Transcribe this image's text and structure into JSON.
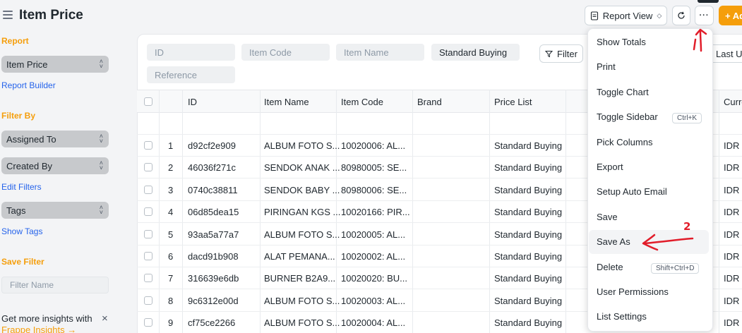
{
  "header": {
    "title": "Item Price",
    "report_view_label": "Report View",
    "more_label": "···",
    "add_label": "+ Ad"
  },
  "sidebar": {
    "report_heading": "Report",
    "report_select": "Item Price",
    "report_builder_link": "Report Builder",
    "filter_by_heading": "Filter By",
    "filter_selects": [
      "Assigned To",
      "Created By"
    ],
    "edit_filters_link": "Edit Filters",
    "tags_select": "Tags",
    "show_tags_link": "Show Tags",
    "save_filter_heading": "Save Filter",
    "filter_name_placeholder": "Filter Name",
    "insights_text": "Get more insights with",
    "insights_link": "Frappe Insights →"
  },
  "filters": {
    "id_placeholder": "ID",
    "item_code_placeholder": "Item Code",
    "item_name_placeholder": "Item Name",
    "price_list_value": "Standard Buying",
    "reference_placeholder": "Reference",
    "filter_button": "Filter",
    "sort_label": "Last Up"
  },
  "table": {
    "columns": [
      "ID",
      "Item Name",
      "Item Code",
      "Brand",
      "Price List",
      "Curre"
    ],
    "rows": [
      {
        "n": "1",
        "id": "d92cf2e909",
        "name": "ALBUM FOTO S...",
        "code": "10020006: AL...",
        "brand": "",
        "price_list": "Standard Buying",
        "currency": "IDR"
      },
      {
        "n": "2",
        "id": "46036f271c",
        "name": "SENDOK ANAK ...",
        "code": "80980005: SE...",
        "brand": "",
        "price_list": "Standard Buying",
        "currency": "IDR"
      },
      {
        "n": "3",
        "id": "0740c38811",
        "name": "SENDOK BABY ...",
        "code": "80980006: SE...",
        "brand": "",
        "price_list": "Standard Buying",
        "currency": "IDR"
      },
      {
        "n": "4",
        "id": "06d85dea15",
        "name": "PIRINGAN KGS ...",
        "code": "10020166: PIR...",
        "brand": "",
        "price_list": "Standard Buying",
        "currency": "IDR"
      },
      {
        "n": "5",
        "id": "93aa5a77a7",
        "name": "ALBUM FOTO S...",
        "code": "10020005: AL...",
        "brand": "",
        "price_list": "Standard Buying",
        "currency": "IDR"
      },
      {
        "n": "6",
        "id": "dacd91b908",
        "name": "ALAT PEMANA...",
        "code": "10020002: AL...",
        "brand": "",
        "price_list": "Standard Buying",
        "currency": "IDR"
      },
      {
        "n": "7",
        "id": "316639e6db",
        "name": "BURNER B2A9...",
        "code": "10020020: BU...",
        "brand": "",
        "price_list": "Standard Buying",
        "currency": "IDR"
      },
      {
        "n": "8",
        "id": "9c6312e00d",
        "name": "ALBUM FOTO S...",
        "code": "10020003: AL...",
        "brand": "",
        "price_list": "Standard Buying",
        "currency": "IDR"
      },
      {
        "n": "9",
        "id": "cf75ce2266",
        "name": "ALBUM FOTO S...",
        "code": "10020004: AL...",
        "brand": "",
        "price_list": "Standard Buying",
        "currency": "IDR"
      }
    ]
  },
  "menu": {
    "items": [
      {
        "label": "Show Totals",
        "shortcut": ""
      },
      {
        "label": "Print",
        "shortcut": ""
      },
      {
        "label": "Toggle Chart",
        "shortcut": ""
      },
      {
        "label": "Toggle Sidebar",
        "shortcut": "Ctrl+K"
      },
      {
        "label": "Pick Columns",
        "shortcut": ""
      },
      {
        "label": "Export",
        "shortcut": ""
      },
      {
        "label": "Setup Auto Email",
        "shortcut": ""
      },
      {
        "label": "Save",
        "shortcut": ""
      },
      {
        "label": "Save As",
        "shortcut": ""
      },
      {
        "label": "Delete",
        "shortcut": "Shift+Ctrl+D"
      },
      {
        "label": "User Permissions",
        "shortcut": ""
      },
      {
        "label": "List Settings",
        "shortcut": ""
      }
    ]
  },
  "annotations": {
    "step1": "1",
    "step2": "2",
    "color": "#e11d2a"
  },
  "colors": {
    "accent": "#f59e0b",
    "link": "#2563eb"
  }
}
